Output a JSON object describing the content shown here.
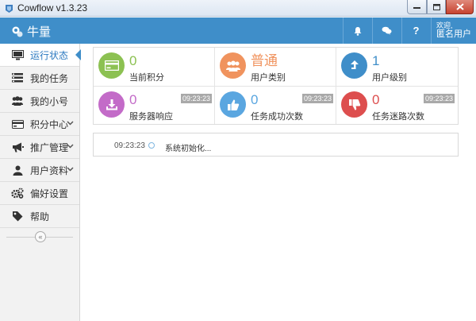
{
  "window": {
    "title": "Cowflow v1.3.23"
  },
  "header": {
    "brand": "牛量",
    "user_greeting": "欢迎,",
    "user_name": "匿名用户",
    "help_label": "?",
    "accent": "#3f8ec9"
  },
  "sidebar": {
    "items": [
      {
        "label": "运行状态",
        "icon": "monitor-icon",
        "active": true
      },
      {
        "label": "我的任务",
        "icon": "task-list-icon"
      },
      {
        "label": "我的小号",
        "icon": "users-icon"
      },
      {
        "label": "积分中心",
        "icon": "credit-card-icon",
        "expandable": true
      },
      {
        "label": "推广管理",
        "icon": "megaphone-icon",
        "expandable": true
      },
      {
        "label": "用户资料",
        "icon": "user-icon",
        "expandable": true
      },
      {
        "label": "偏好设置",
        "icon": "gears-icon"
      },
      {
        "label": "帮助",
        "icon": "tag-icon"
      }
    ],
    "collapse_glyph": "«"
  },
  "stats": [
    {
      "value": "0",
      "label": "当前积分",
      "color": "#8cc152",
      "icon": "credit-card-icon"
    },
    {
      "value": "普通",
      "label": "用户类别",
      "color": "#f0935e",
      "icon": "group-icon"
    },
    {
      "value": "1",
      "label": "用户级别",
      "color": "#3f8ec9",
      "icon": "level-up-icon"
    },
    {
      "value": "0",
      "label": "服务器响应",
      "color": "#c36bc8",
      "icon": "download-icon",
      "time": "09:23:23"
    },
    {
      "value": "0",
      "label": "任务成功次数",
      "color": "#5aa6e0",
      "icon": "thumbs-up-icon",
      "time": "09:23:23"
    },
    {
      "value": "0",
      "label": "任务迷路次数",
      "color": "#dd4e4e",
      "icon": "thumbs-down-icon",
      "time": "09:23:23"
    }
  ],
  "log": [
    {
      "time": "09:23:23",
      "text": "系统初始化..."
    }
  ]
}
